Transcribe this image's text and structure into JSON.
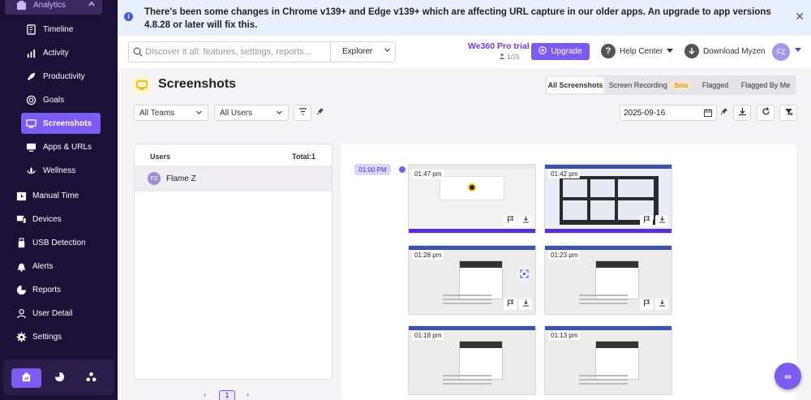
{
  "colors": {
    "brand": "#7c5cf0",
    "sidebar_bg": "#1b1036",
    "banner_bg": "#e8f0fe"
  },
  "sidebar": {
    "analytics_label": "Analytics",
    "sub_items": [
      {
        "label": "Timeline",
        "icon": "timeline-icon"
      },
      {
        "label": "Activity",
        "icon": "activity-icon"
      },
      {
        "label": "Productivity",
        "icon": "rocket-icon"
      },
      {
        "label": "Goals",
        "icon": "target-icon"
      },
      {
        "label": "Screenshots",
        "icon": "monitor-icon"
      },
      {
        "label": "Apps & URLs",
        "icon": "apps-icon"
      },
      {
        "label": "Wellness",
        "icon": "lotus-icon"
      }
    ],
    "top_items": [
      {
        "label": "Manual Time",
        "icon": "clock-icon"
      },
      {
        "label": "Devices",
        "icon": "devices-icon"
      },
      {
        "label": "USB Detection",
        "icon": "usb-icon"
      },
      {
        "label": "Alerts",
        "icon": "bell-icon"
      },
      {
        "label": "Reports",
        "icon": "pie-chart-icon"
      },
      {
        "label": "User Detail",
        "icon": "user-icon"
      },
      {
        "label": "Settings",
        "icon": "gear-icon"
      }
    ]
  },
  "banner": {
    "text": "There's been some changes in Chrome v139+ and Edge v139+ which are affecting URL capture in our older apps. An upgrade to app versions 4.8.28 or later will fix this.",
    "close": "✕"
  },
  "header": {
    "search_placeholder": "Discover it all: features, settings, reports...",
    "explorer_label": "Explorer",
    "trial_label": "We360 Pro trial",
    "trial_users": "1/25",
    "upgrade_label": "Upgrade",
    "help_label": "Help Center",
    "download_label": "Download Myzen",
    "avatar_initials": "FZ"
  },
  "page": {
    "title": "Screenshots",
    "tabs": [
      "All Screenshots",
      "Screen Recording",
      "Flagged",
      "Flagged By Me"
    ],
    "beta_label": "Beta",
    "team_filter": "All Teams",
    "user_filter": "All Users",
    "date": "2025-09-16"
  },
  "users_panel": {
    "header": "Users",
    "total": "Total:1",
    "users": [
      {
        "initials": "FZ",
        "name": "Flame Z"
      }
    ],
    "pager_prev": "‹",
    "pager_page": "1",
    "pager_next": "›"
  },
  "gallery": {
    "hour_label": "01:00 PM",
    "times": [
      "01:47 pm",
      "01:42 pm",
      "01:28 pm",
      "01:23 pm",
      "01:18 pm",
      "01:13 pm"
    ]
  },
  "fab_label": "∞"
}
